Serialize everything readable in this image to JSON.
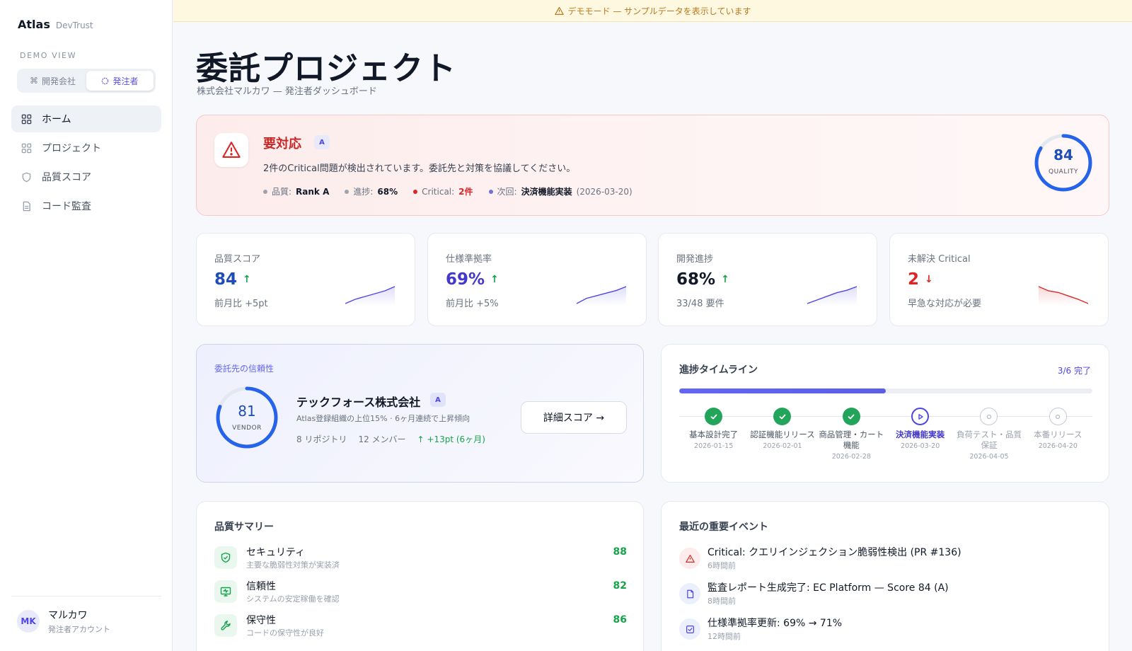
{
  "brand": {
    "name": "Atlas",
    "sub": "DevTrust"
  },
  "sidebar": {
    "demo_label": "DEMO VIEW",
    "toggle": [
      {
        "label": "開発会社",
        "icon": "command-icon"
      },
      {
        "label": "発注者",
        "icon": "circle-icon"
      }
    ],
    "nav": [
      {
        "label": "ホーム",
        "icon": "grid-icon"
      },
      {
        "label": "プロジェクト",
        "icon": "grid-icon"
      },
      {
        "label": "品質スコア",
        "icon": "shield-icon"
      },
      {
        "label": "コード監査",
        "icon": "document-icon"
      }
    ],
    "user": {
      "initials": "MK",
      "name": "マルカワ",
      "role": "発注者アカウント"
    }
  },
  "banner": {
    "text": "デモモード — サンプルデータを表示しています"
  },
  "header": {
    "title": "委託プロジェクト",
    "subtitle": "株式会社マルカワ — 発注者ダッシュボード"
  },
  "alert": {
    "title": "要対応",
    "badge": "A",
    "message": "2件のCritical問題が検出されています。委託先と対策を協議してください。",
    "meta": {
      "quality_label": "品質:",
      "quality_value": "Rank A",
      "progress_label": "進捗:",
      "progress_value": "68%",
      "critical_label": "Critical:",
      "critical_value": "2件",
      "next_label": "次回:",
      "next_value": "決済機能実装",
      "next_date": "(2026-03-20)"
    },
    "quality_score": "84",
    "quality_score_value": 84,
    "quality_label": "QUALITY"
  },
  "kpis": [
    {
      "label": "品質スコア",
      "value": "84",
      "arrow": "↑",
      "note": "前月比 +5pt",
      "color": "#1e4db7",
      "arrow_color": "#16a34a",
      "trend": [
        72,
        75,
        77,
        79,
        81,
        84
      ]
    },
    {
      "label": "仕様準拠率",
      "value": "69%",
      "arrow": "↑",
      "note": "前月比 +5%",
      "color": "#4338ca",
      "arrow_color": "#16a34a",
      "trend": [
        56,
        60,
        62,
        64,
        66,
        69
      ]
    },
    {
      "label": "開発進捗",
      "value": "68%",
      "arrow": "↑",
      "note": "33/48 要件",
      "color": "#111827",
      "arrow_color": "#16a34a",
      "trend": [
        54,
        57,
        60,
        63,
        65,
        68
      ]
    },
    {
      "label": "未解決 Critical",
      "value": "2",
      "arrow": "↓",
      "note": "早急な対応が必要",
      "color": "#dc2626",
      "arrow_color": "#dc2626",
      "trend": [
        6,
        5,
        4.6,
        3.8,
        3,
        2
      ]
    }
  ],
  "vendor": {
    "section_label": "委託先の信頼性",
    "score": "81",
    "score_value": 81,
    "score_label": "VENDOR",
    "name": "テックフォース株式会社",
    "badge": "A",
    "description": "Atlas登録組織の上位15% · 6ヶ月連続で上昇傾向",
    "repos": "8 リポジトリ",
    "members": "12 メンバー",
    "trend": "↑ +13pt (6ヶ月)",
    "button": "詳細スコア →"
  },
  "timeline": {
    "title": "進捗タイムライン",
    "count": "3/6 完了",
    "progress": 0.5,
    "steps": [
      {
        "name": "基本設計完了",
        "date": "2026-01-15",
        "status": "done"
      },
      {
        "name": "認証機能リリース",
        "date": "2026-02-01",
        "status": "done"
      },
      {
        "name": "商品管理・カート機能",
        "date": "2026-02-28",
        "status": "done"
      },
      {
        "name": "決済機能実装",
        "date": "2026-03-20",
        "status": "current"
      },
      {
        "name": "負荷テスト・品質保証",
        "date": "2026-04-05",
        "status": "pending"
      },
      {
        "name": "本番リリース",
        "date": "2026-04-20",
        "status": "pending"
      }
    ]
  },
  "quality_summary": {
    "title": "品質サマリー",
    "items": [
      {
        "name": "セキュリティ",
        "desc": "主要な脆弱性対策が実装済",
        "score": "88",
        "icon": "shield-check-icon"
      },
      {
        "name": "信頼性",
        "desc": "システムの安定稼働を確認",
        "score": "82",
        "icon": "monitor-icon"
      },
      {
        "name": "保守性",
        "desc": "コードの保守性が良好",
        "score": "86",
        "icon": "wrench-icon"
      }
    ]
  },
  "events": {
    "title": "最近の重要イベント",
    "items": [
      {
        "text": "Critical: クエリインジェクション脆弱性検出 (PR #136)",
        "time": "6時間前",
        "icon": "warning-icon",
        "tone": "red"
      },
      {
        "text": "監査レポート生成完了: EC Platform — Score 84 (A)",
        "time": "8時間前",
        "icon": "document-icon",
        "tone": "blue"
      },
      {
        "text": "仕様準拠率更新: 69% → 71%",
        "time": "12時間前",
        "icon": "checkbox-icon",
        "tone": "blue"
      }
    ]
  }
}
